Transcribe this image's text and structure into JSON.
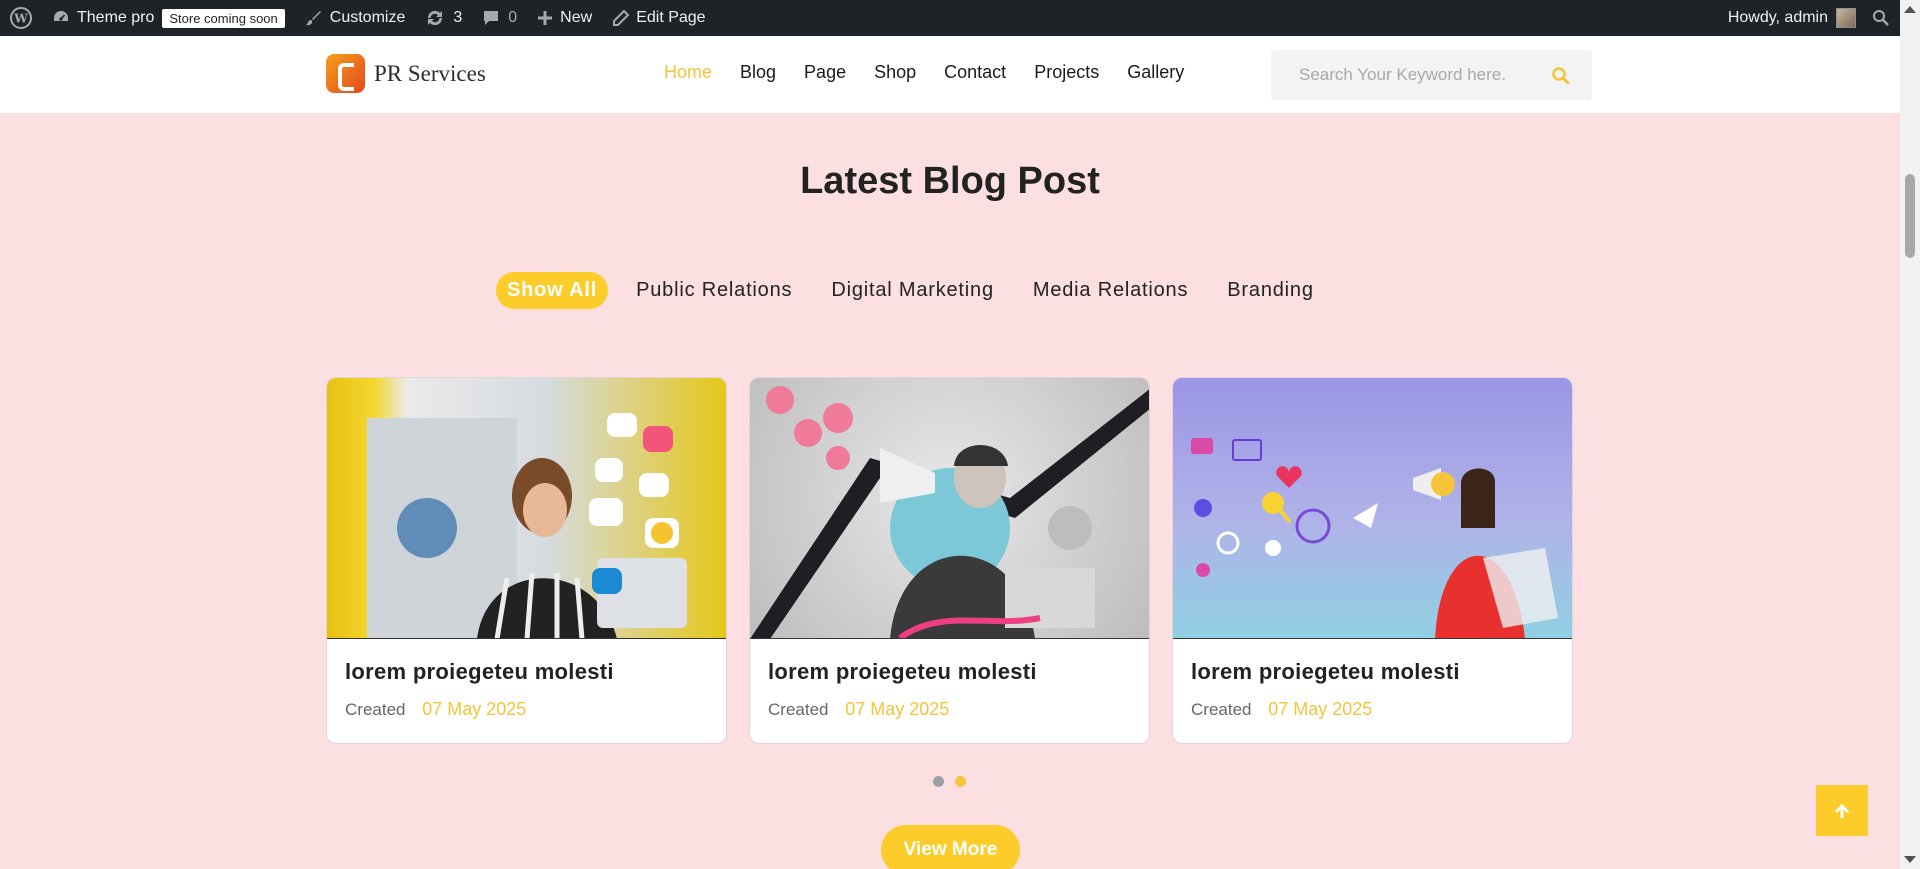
{
  "admin_bar": {
    "site_name": "Theme pro",
    "store_badge": "Store coming soon",
    "customize": "Customize",
    "updates_count": "3",
    "comments_count": "0",
    "new": "New",
    "edit_page": "Edit Page",
    "howdy": "Howdy, admin"
  },
  "header": {
    "logo_text": "PR Services",
    "nav": [
      "Home",
      "Blog",
      "Page",
      "Shop",
      "Contact",
      "Projects",
      "Gallery"
    ],
    "active_nav": "Home",
    "search_placeholder": "Search Your Keyword here."
  },
  "section": {
    "title": "Latest Blog Post",
    "filters": [
      "Show All",
      "Public Relations",
      "Digital Marketing",
      "Media Relations",
      "Branding"
    ],
    "active_filter": "Show All"
  },
  "posts": [
    {
      "title": "lorem proiegeteu molesti",
      "meta_label": "Created",
      "date": "07 May 2025"
    },
    {
      "title": "lorem proiegeteu molesti",
      "meta_label": "Created",
      "date": "07 May 2025"
    },
    {
      "title": "lorem proiegeteu molesti",
      "meta_label": "Created",
      "date": "07 May 2025"
    }
  ],
  "slider": {
    "pages": 2,
    "active_page": 2
  },
  "view_more": "View More",
  "colors": {
    "accent": "#fccd2a",
    "section_bg": "#fcdfe1",
    "admin_bar": "#1d2327"
  }
}
